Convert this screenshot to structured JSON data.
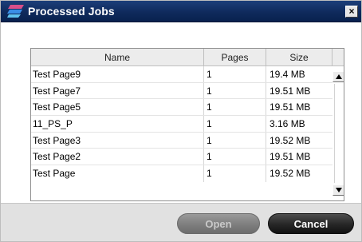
{
  "window": {
    "title": "Processed Jobs",
    "close_glyph": "×",
    "app_icon": "app-logo-icon"
  },
  "table": {
    "columns": [
      "Name",
      "Pages",
      "Size"
    ],
    "rows": [
      {
        "name": "Test Page9",
        "pages": "1",
        "size": "19.4 MB"
      },
      {
        "name": "Test Page7",
        "pages": "1",
        "size": "19.51 MB"
      },
      {
        "name": "Test Page5",
        "pages": "1",
        "size": "19.51 MB"
      },
      {
        "name": "11_PS_P",
        "pages": "1",
        "size": "3.16 MB"
      },
      {
        "name": "Test Page3",
        "pages": "1",
        "size": "19.52 MB"
      },
      {
        "name": "Test Page2",
        "pages": "1",
        "size": "19.51 MB"
      },
      {
        "name": "Test Page",
        "pages": "1",
        "size": "19.52 MB"
      }
    ]
  },
  "buttons": {
    "open_label": "Open",
    "cancel_label": "Cancel"
  },
  "colors": {
    "titlebar": "#0f2a5c",
    "footer": "#e1e1e1",
    "open_disabled": "#7c7c7c",
    "cancel": "#262626"
  }
}
